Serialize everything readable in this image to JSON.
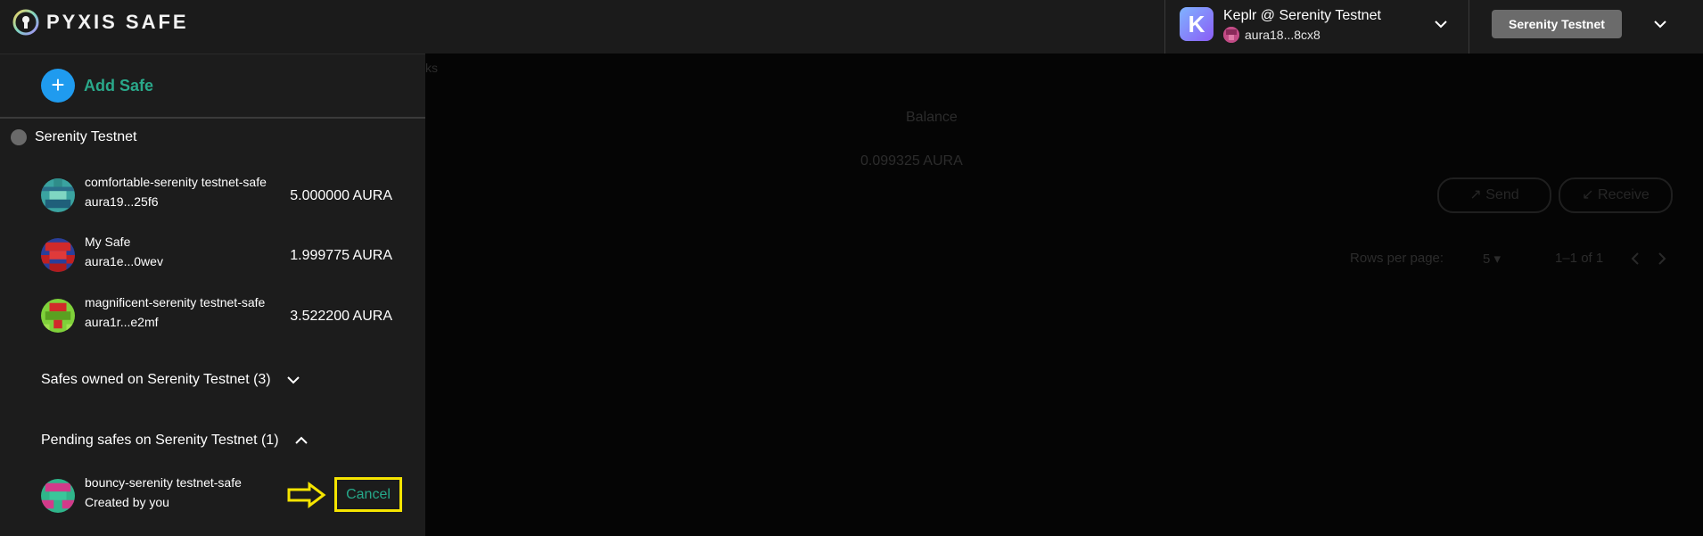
{
  "header": {
    "app_name": "PYXIS SAFE",
    "wallet": {
      "avatar_letter": "K",
      "name": "Keplr @ Serenity Testnet",
      "address": "aura18...8cx8"
    },
    "network_button": "Serenity Testnet"
  },
  "background": {
    "tab_fragment": "ks",
    "balance_header": "Balance",
    "balance_value": "0.099325 AURA",
    "send_label": "↗ Send",
    "receive_label": "↙ Receive",
    "rows_per_page_label": "Rows per page:",
    "rows_per_page_value": "5 ▾",
    "pagination_range": "1–1 of 1"
  },
  "sidebar": {
    "add_safe_label": "Add Safe",
    "network_label": "Serenity Testnet",
    "safes": [
      {
        "name": "comfortable-serenity testnet-safe",
        "address": "aura19...25f6",
        "balance": "5.000000 AURA"
      },
      {
        "name": "My Safe",
        "address": "aura1e...0wev",
        "balance": "1.999775 AURA"
      },
      {
        "name": "magnificent-serenity testnet-safe",
        "address": "aura1r...e2mf",
        "balance": "3.522200 AURA"
      }
    ],
    "owned_section": "Safes owned on Serenity Testnet (3)",
    "pending_section": "Pending safes on Serenity Testnet (1)",
    "pending": {
      "name": "bouncy-serenity testnet-safe",
      "created_by": "Created by you",
      "cancel_label": "Cancel"
    }
  },
  "colors": {
    "accent_green": "#2aa88a",
    "accent_blue": "#1f9bef",
    "highlight_yellow": "#f5e400"
  }
}
